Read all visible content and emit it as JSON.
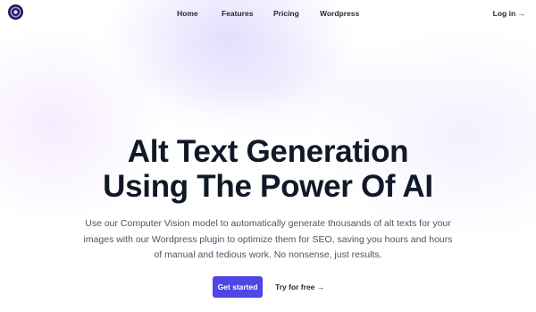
{
  "nav": {
    "logo_icon": "brand-logo-icon",
    "links": [
      "Home",
      "Features",
      "Pricing",
      "Wordpress"
    ],
    "login_label": "Log in →"
  },
  "hero": {
    "title_line1": "Alt Text Generation",
    "title_line2": "Using The Power Of AI",
    "description": "Use our Computer Vision model to automatically generate thousands of alt texts for your images with our Wordpress plugin to optimize them for SEO, saving you hours and hours of manual and tedious work. No nonsense, just results."
  },
  "cta": {
    "primary_label": "Get started",
    "secondary_label": "Try for free →"
  },
  "colors": {
    "accent": "#4f46e5",
    "heading": "#111827",
    "body_text": "#4b5563"
  }
}
